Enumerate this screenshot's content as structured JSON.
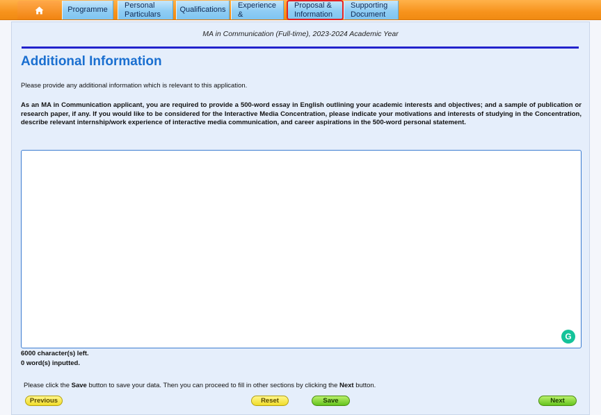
{
  "tabs": {
    "home_icon": "home-icon",
    "items": [
      {
        "label1": "Programme",
        "label2": ""
      },
      {
        "label1": "Personal",
        "label2": "Particulars"
      },
      {
        "label1": "Qualifications",
        "label2": ""
      },
      {
        "label1": "Experience",
        "label2": "&"
      },
      {
        "label1": "Proposal &",
        "label2": "Information"
      },
      {
        "label1": "Supporting",
        "label2": "Document"
      }
    ],
    "selected_index": 4,
    "colors": {
      "bar": "#f7931d",
      "tab": "#8fcdf4",
      "selected_outline": "#e32222"
    }
  },
  "main": {
    "subtitle": "MA in Communication (Full-time), 2023-2024 Academic Year",
    "heading": "Additional Information",
    "intro": "Please provide any additional information which is relevant to this application.",
    "paragraph": "As an MA in Communication applicant, you are required to provide a 500-word essay in English outlining your academic interests and objectives; and a sample of publication or research paper, if any. If you would like to be considered for the Interactive Media Concentration, please indicate your motivations and interests of studying in the Concentration, describe relevant internship/work experience of interactive media communication, and career aspirations in the 500-word personal statement.",
    "essay_value": "",
    "chars_left": "6000 character(s) left.",
    "words_inputted": "0 word(s) inputted.",
    "instruction": {
      "part1": "Please click the ",
      "save_word": "Save",
      "part2": " button to save your data. Then you can proceed to fill in other sections by clicking the ",
      "next_word": "Next",
      "part3": " button."
    },
    "accent_color": "#1a6fd0"
  },
  "buttons": {
    "previous": "Previous",
    "reset": "Reset",
    "save": "Save",
    "next": "Next"
  }
}
